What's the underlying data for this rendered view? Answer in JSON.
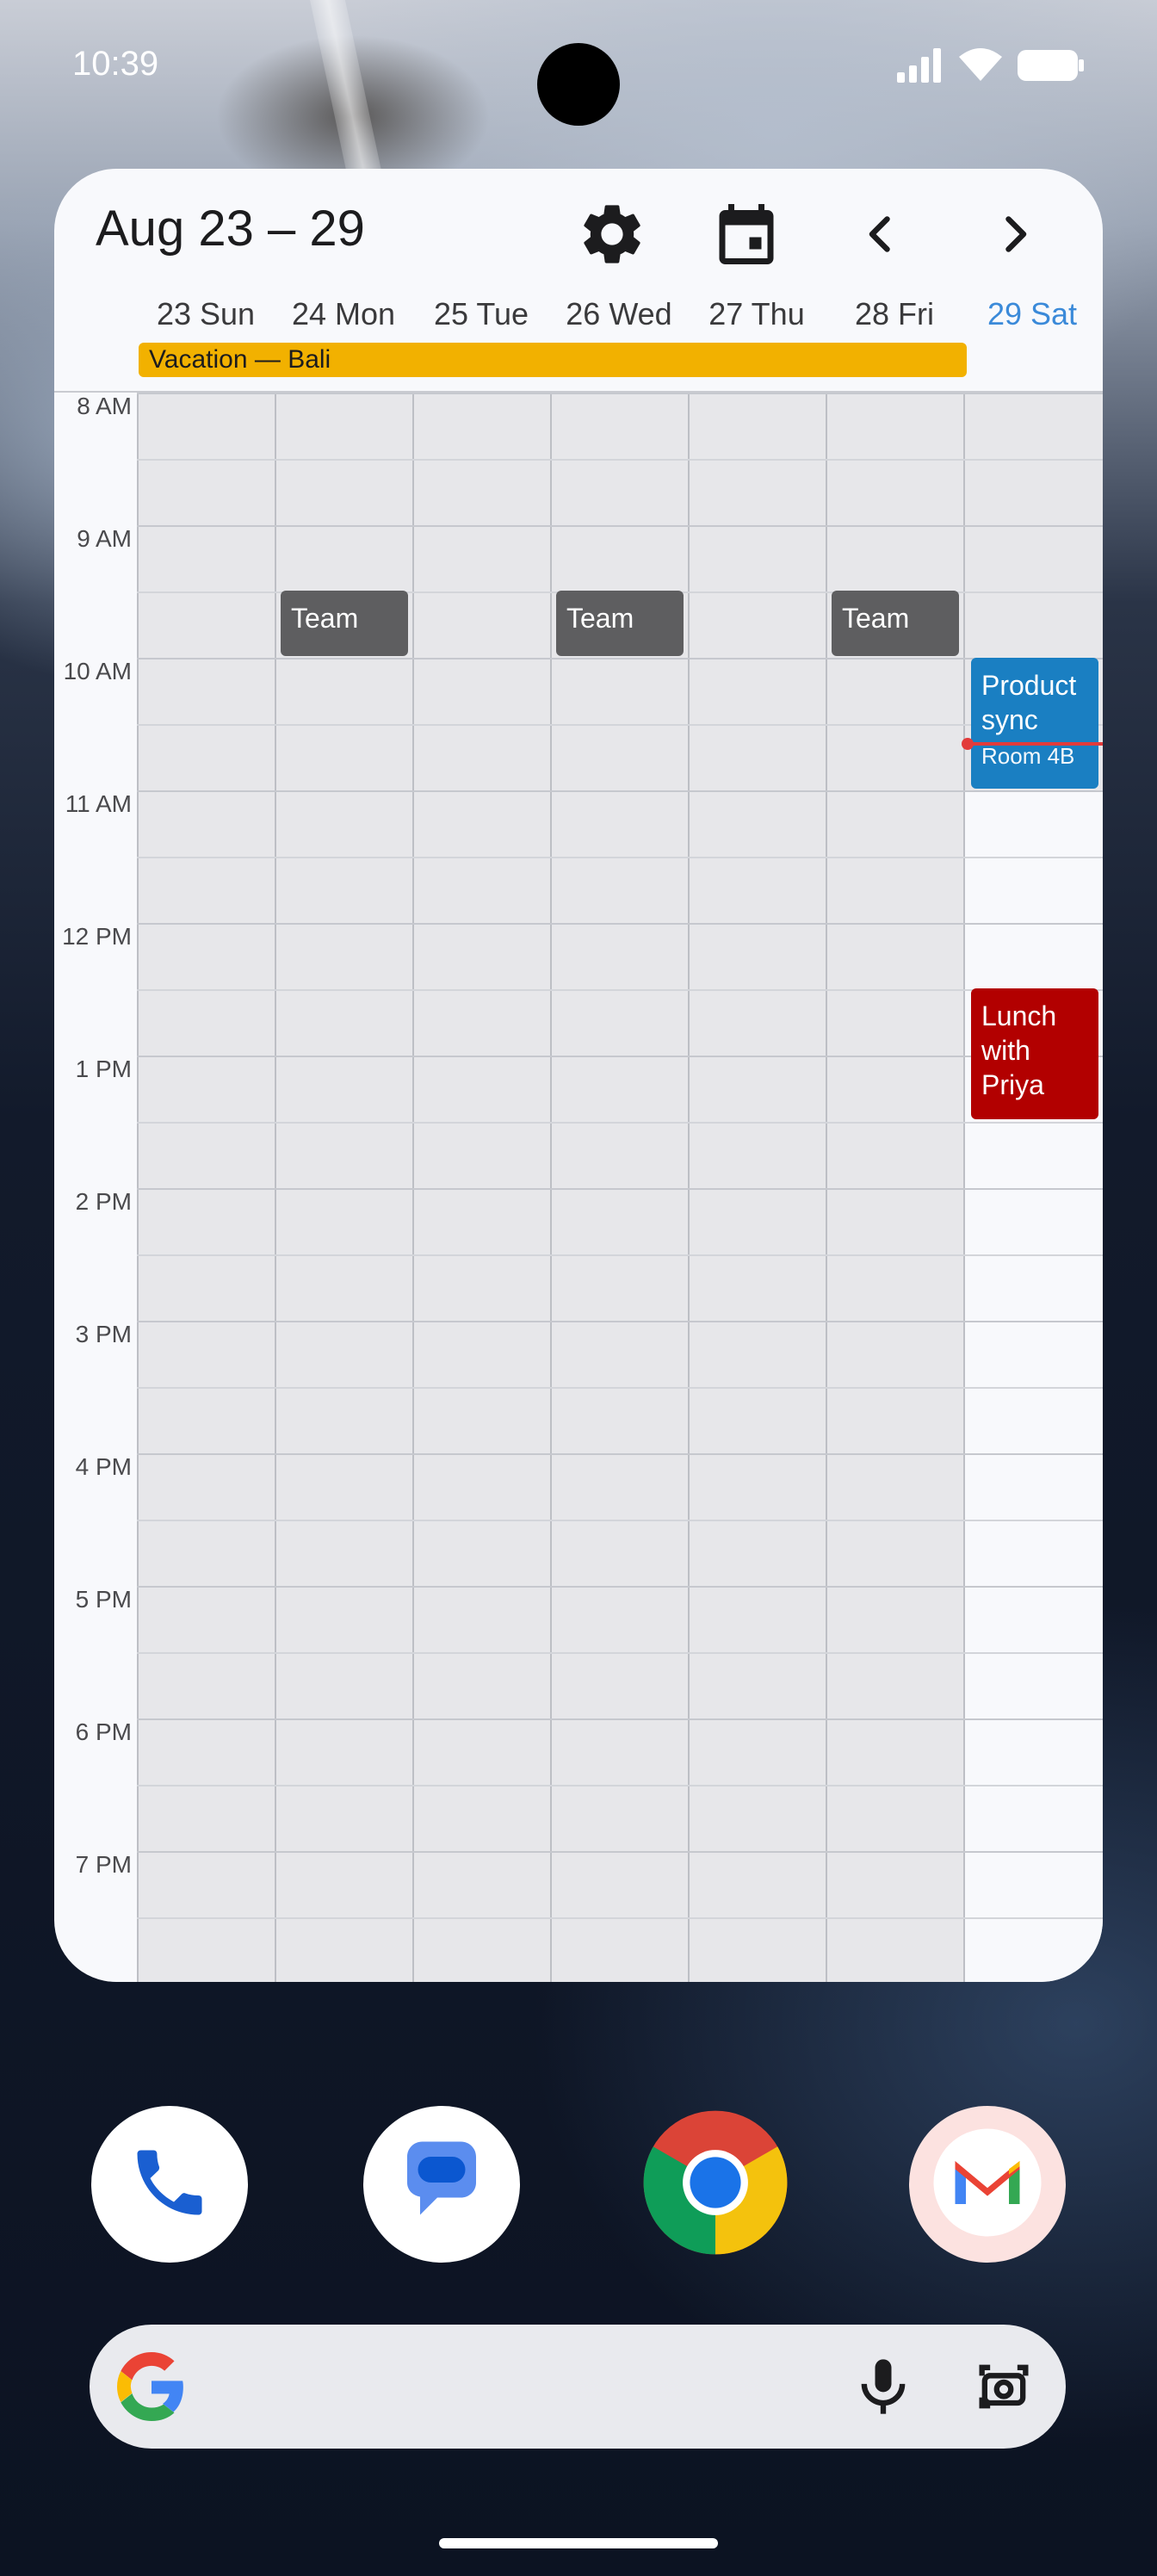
{
  "status_bar": {
    "time": "10:39"
  },
  "widget": {
    "title": "Aug 23 – 29",
    "icons": [
      "settings-gear-icon",
      "calendar-today-icon",
      "chevron-left-icon",
      "chevron-right-icon"
    ],
    "days": [
      {
        "label": "23 Sun",
        "today": false
      },
      {
        "label": "24 Mon",
        "today": false
      },
      {
        "label": "25 Tue",
        "today": false
      },
      {
        "label": "26 Wed",
        "today": false
      },
      {
        "label": "27 Thu",
        "today": false
      },
      {
        "label": "28 Fri",
        "today": false
      },
      {
        "label": "29 Sat",
        "today": true
      }
    ],
    "all_day_event": {
      "title": "Vacation — Bali",
      "color": "#f2b100"
    },
    "hours": [
      "8 AM",
      "9 AM",
      "10 AM",
      "11 AM",
      "12 PM",
      "1 PM",
      "2 PM",
      "3 PM",
      "4 PM",
      "5 PM",
      "6 PM",
      "7 PM"
    ],
    "events": {
      "team_mon": {
        "title": "Team",
        "color": "#5e5e60"
      },
      "team_wed": {
        "title": "Team",
        "color": "#5e5e60"
      },
      "team_fri": {
        "title": "Team",
        "color": "#5e5e60"
      },
      "product_sync": {
        "title": "Product sync",
        "location": "Room 4B",
        "color": "#1a7fc2"
      },
      "lunch": {
        "title": "Lunch with Priya",
        "color": "#b20000"
      }
    },
    "today_color": "#3b8ad9",
    "now_indicator_color": "#e23b3b"
  },
  "dock": {
    "apps": [
      "phone-icon",
      "messages-icon",
      "chrome-icon",
      "gmail-icon"
    ]
  },
  "search_bar": {
    "icons": [
      "google-g-icon",
      "microphone-icon",
      "lens-camera-icon"
    ]
  }
}
